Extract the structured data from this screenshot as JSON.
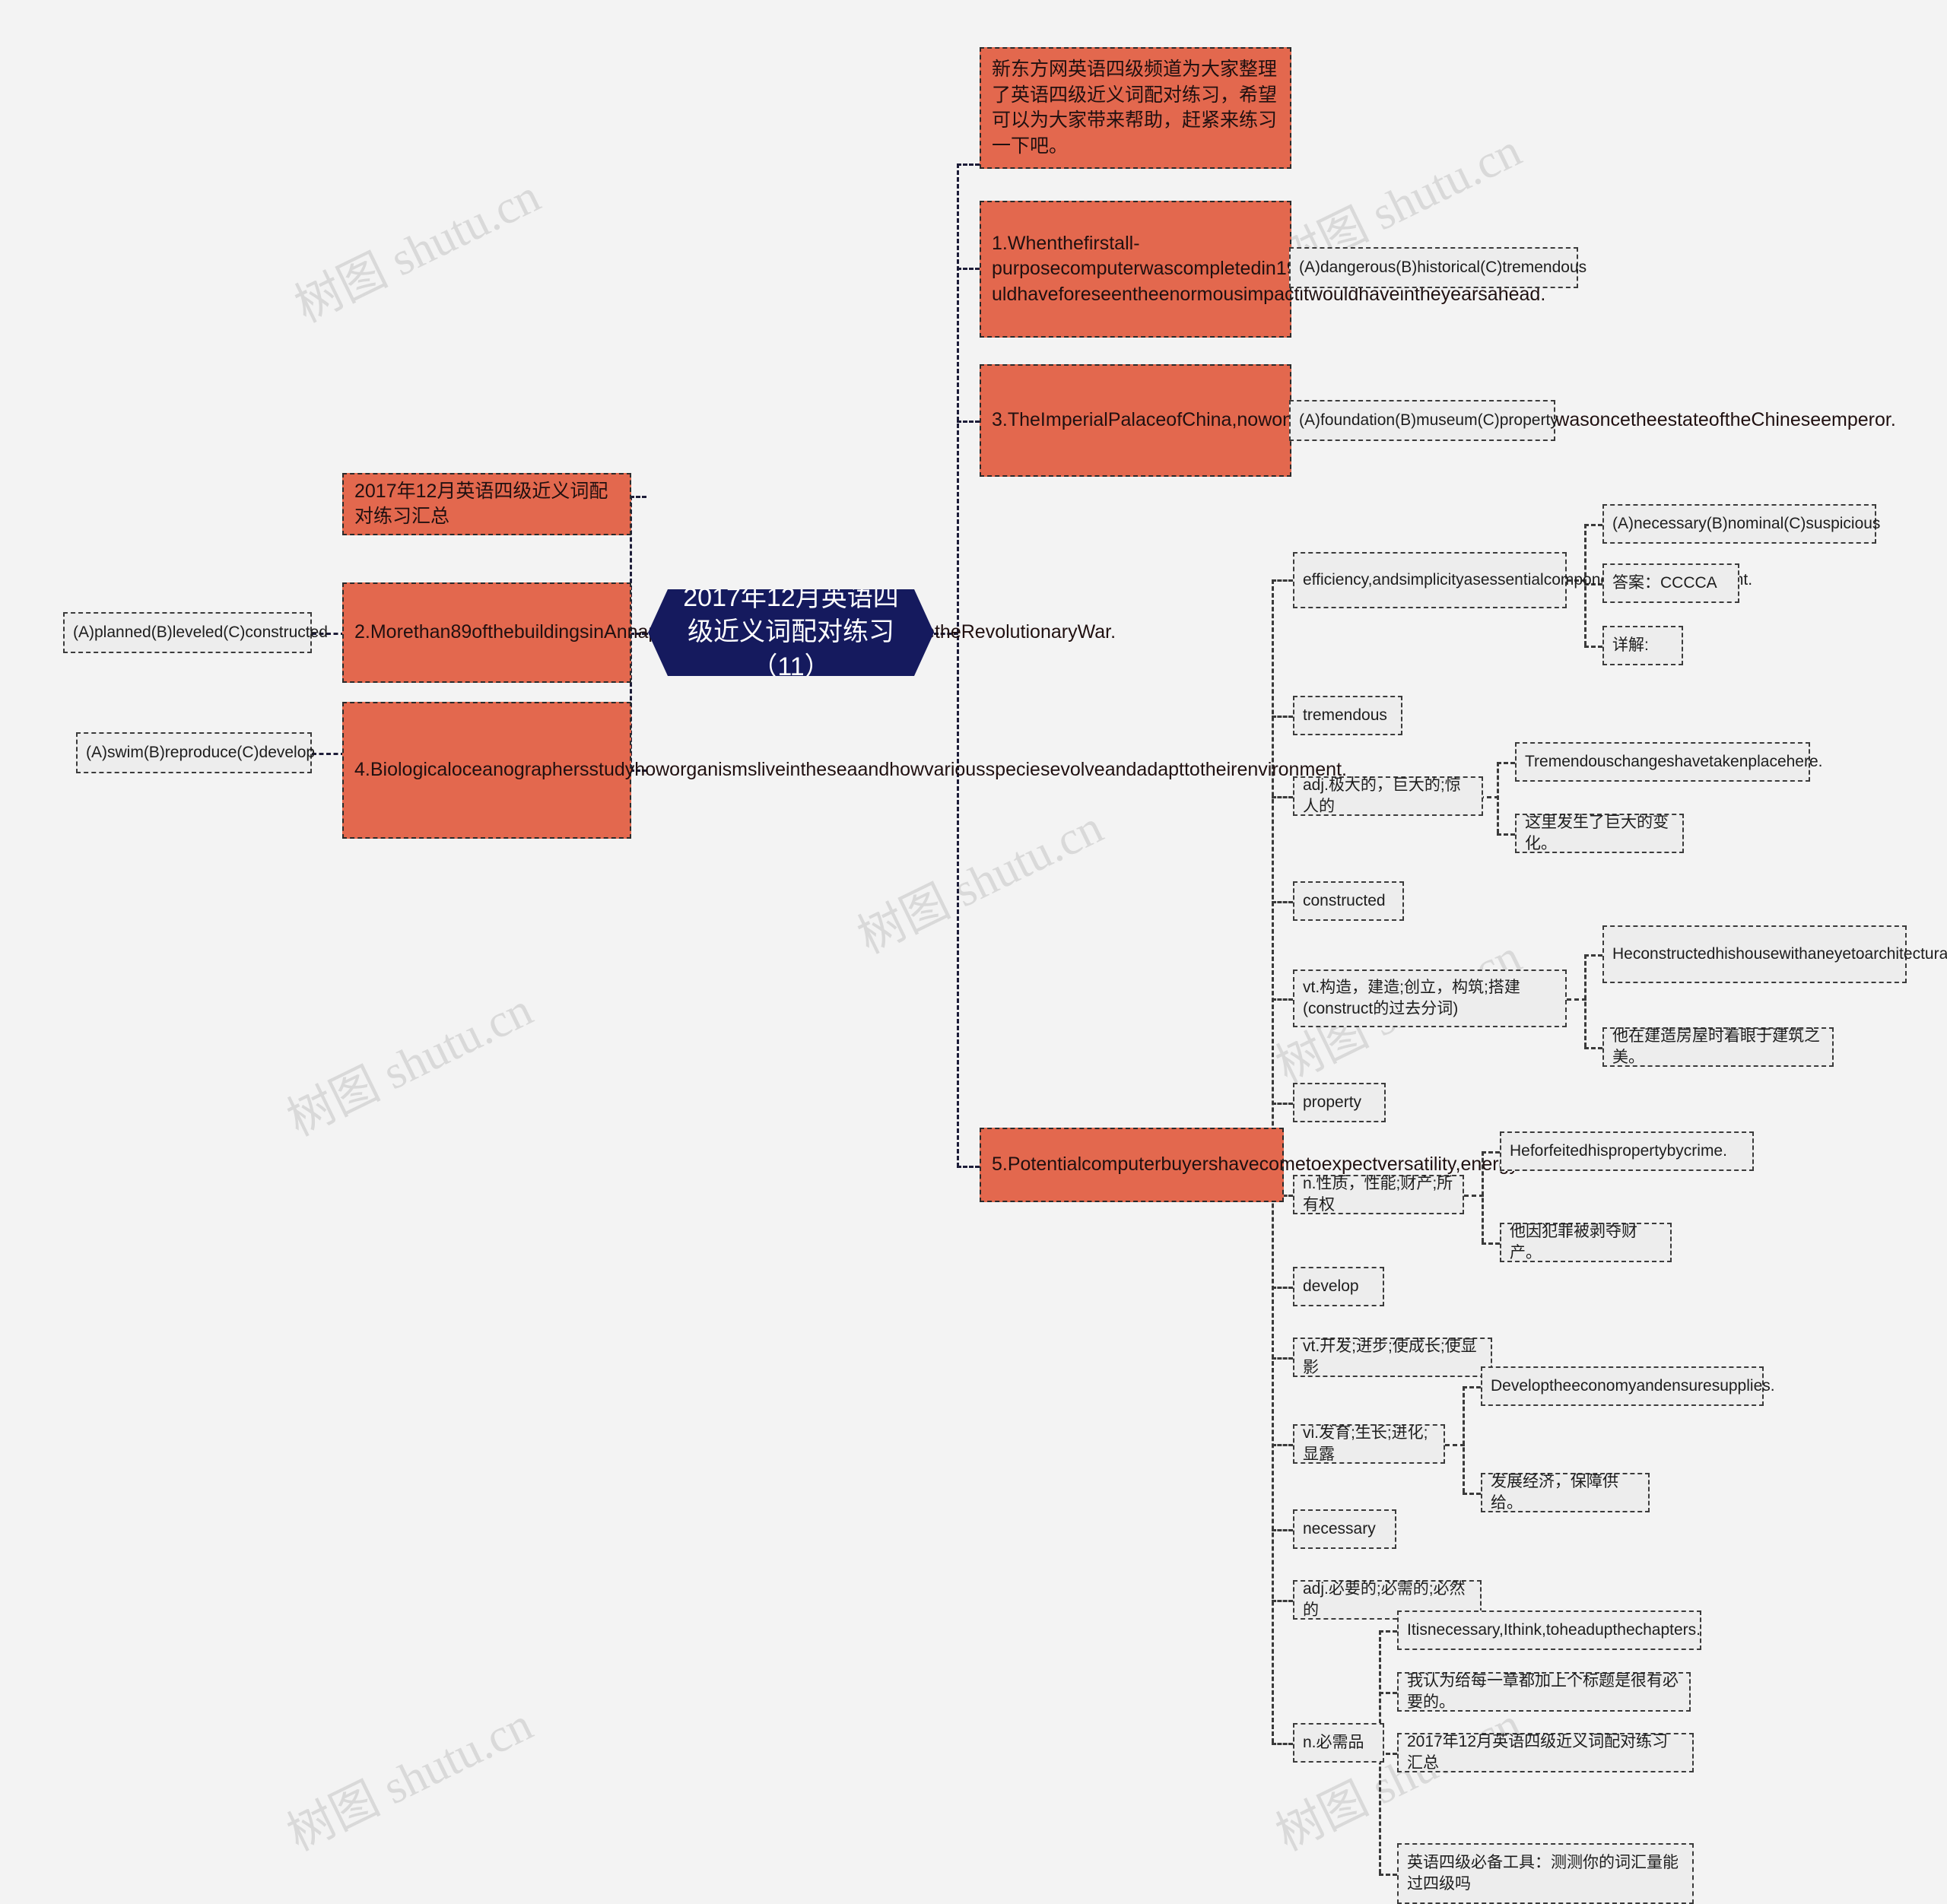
{
  "page": {
    "background_color": "#f3f3f3",
    "accent_orange": "#e3684e",
    "accent_navy": "#151a5e",
    "watermark_text": "树图 shutu.cn"
  },
  "center": {
    "title": "2017年12月英语四级近义词配对练习（11）"
  },
  "left_branch": [
    {
      "id": "l1",
      "label": "2017年12月英语四级近义词配对练习汇总",
      "children": []
    },
    {
      "id": "l2",
      "label": "2.Morethan89ofthebuildingsinAnnapolis,Maryland,wereerectedbeforetheRevolutionaryWar.",
      "children": [
        {
          "id": "l2c1",
          "label": "(A)planned(B)leveled(C)constructed"
        }
      ]
    },
    {
      "id": "l3",
      "label": "4.Biologicaloceanographersstudyhoworganismsliveintheseaandhowvariousspeciesevolveandadapttotheirenvironment.",
      "children": [
        {
          "id": "l3c1",
          "label": "(A)swim(B)reproduce(C)develop"
        }
      ]
    }
  ],
  "right_branch": [
    {
      "id": "r0",
      "label": "新东方网英语四级频道为大家整理了英语四级近义词配对练习，希望可以为大家带来帮助，赶紧来练习一下吧。",
      "children": []
    },
    {
      "id": "r1",
      "label": "1.Whenthefirstall-purposecomputerwascompletedin1946,nooneco uldhaveforeseentheenormousimpactitwouldhaveintheyearsahead.",
      "label_display": "1.Whenthefirstall-purposecomputerwascompletedin1946,nooneco\nuldhaveforeseentheenormous\nimpactitwouldhaveintheyearsah\nead.",
      "children": [
        {
          "id": "r1c1",
          "label": "(A)dangerous(B)historical(C)tremendous"
        }
      ]
    },
    {
      "id": "r2",
      "label": "3.TheImperialPalaceofChina,nowoneoftheworld'sgreatestmuseumswasoncetheestateoftheChineseemperor.",
      "children": [
        {
          "id": "r2c1",
          "label": "(A)foundation(B)museum(C)property"
        }
      ]
    },
    {
      "id": "r3",
      "label": "5.Potentialcomputerbuyershavecometoexpectversatility,energy",
      "children": []
    }
  ],
  "right_detail": [
    {
      "id": "d1",
      "label": "efficiency,andsimplicityasessentialcomponentsofnewequipment.",
      "children": [
        {
          "id": "d1c1",
          "label": "(A)necessary(B)nominal(C)suspicious"
        },
        {
          "id": "d1c2",
          "label": "答案：CCCCA"
        },
        {
          "id": "d1c3",
          "label": "详解:"
        }
      ]
    },
    {
      "id": "d2",
      "label": "tremendous",
      "children": []
    },
    {
      "id": "d3",
      "label": "adj.极大的，巨大的;惊人的",
      "children": [
        {
          "id": "d3c1",
          "label": "Tremendouschangeshavetakenplacehere."
        },
        {
          "id": "d3c2",
          "label": "这里发生了巨大的变化。"
        }
      ]
    },
    {
      "id": "d4",
      "label": "constructed",
      "children": []
    },
    {
      "id": "d5",
      "label": "vt.构造，建造;创立，构筑;搭建(construct的过去分词)",
      "children": [
        {
          "id": "d5c1",
          "label": "Heconstructedhishousewithaneyetoarchitecturalbeauty."
        },
        {
          "id": "d5c2",
          "label": "他在建造房屋时着眼于建筑之美。"
        }
      ]
    },
    {
      "id": "d6",
      "label": "property",
      "children": []
    },
    {
      "id": "d7",
      "label": "n.性质，性能;财产;所有权",
      "children": [
        {
          "id": "d7c1",
          "label": "Heforfeitedhispropertybycrime."
        },
        {
          "id": "d7c2",
          "label": "他因犯罪被剥夺财产。"
        }
      ]
    },
    {
      "id": "d8",
      "label": "develop",
      "children": []
    },
    {
      "id": "d9",
      "label": "vt.开发;进步;使成长;使显影",
      "children": []
    },
    {
      "id": "d10",
      "label": "vi.发育;生长;进化;显露",
      "children": [
        {
          "id": "d10c1",
          "label": "Developtheeconomyandensuresupplies."
        },
        {
          "id": "d10c2",
          "label": "发展经济，保障供给。"
        }
      ]
    },
    {
      "id": "d11",
      "label": "necessary",
      "children": []
    },
    {
      "id": "d12",
      "label": "adj.必要的;必需的;必然的",
      "children": []
    },
    {
      "id": "d13",
      "label": "n.必需品",
      "children": [
        {
          "id": "d13c1",
          "label": "Itisnecessary,Ithink,toheadupthechapters."
        },
        {
          "id": "d13c2",
          "label": "我认为给每一章都加上个标题是很有必要的。"
        },
        {
          "id": "d13c3",
          "label": "2017年12月英语四级近义词配对练习汇总"
        },
        {
          "id": "d13c4",
          "label": "英语四级必备工具：测测你的词汇量能过四级吗"
        }
      ]
    }
  ]
}
